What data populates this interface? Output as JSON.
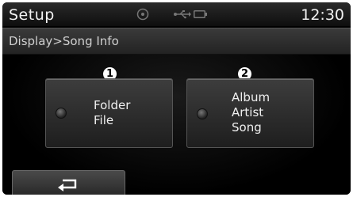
{
  "header": {
    "title": "Setup",
    "time": "12:30"
  },
  "status_icons": [
    "disc-icon",
    "usb-icon",
    "battery-icon"
  ],
  "breadcrumb": "Display>Song Info",
  "options": [
    {
      "callout": "1",
      "lines": [
        "Folder",
        "File"
      ],
      "icon": "radio-icon"
    },
    {
      "callout": "2",
      "lines": [
        "Album",
        "Artist",
        "Song"
      ],
      "icon": "radio-icon"
    }
  ],
  "back_button": {
    "icon": "back-arrow-icon"
  }
}
